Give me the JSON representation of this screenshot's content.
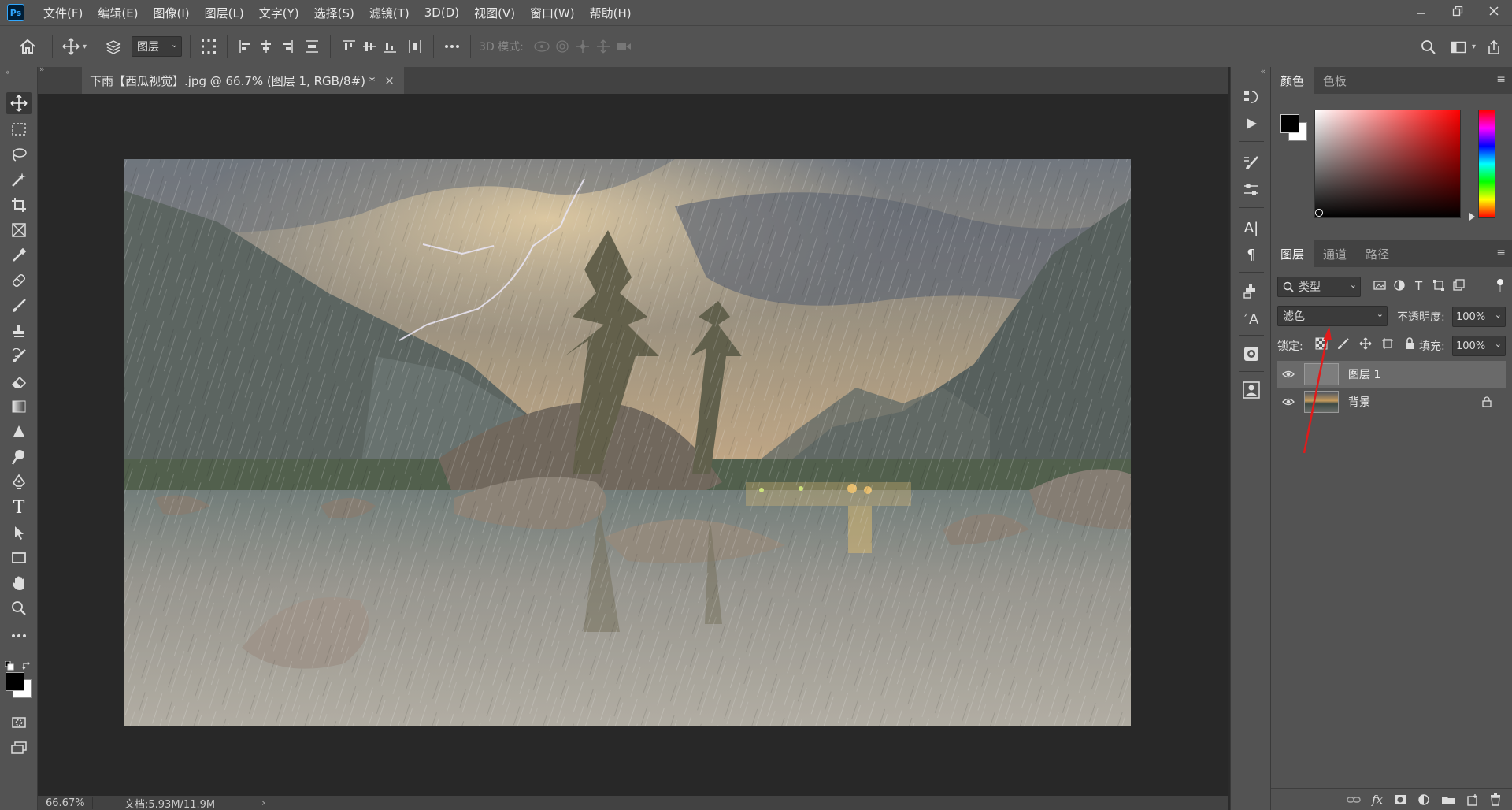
{
  "app": {
    "logo": "Ps"
  },
  "menu": [
    "文件(F)",
    "编辑(E)",
    "图像(I)",
    "图层(L)",
    "文字(Y)",
    "选择(S)",
    "滤镜(T)",
    "3D(D)",
    "视图(V)",
    "窗口(W)",
    "帮助(H)"
  ],
  "options": {
    "layer_select": "图层",
    "mode3d_label": "3D 模式:"
  },
  "document": {
    "tab_title": "下雨【西瓜视觉】.jpg @ 66.7% (图层 1, RGB/8#) *"
  },
  "status": {
    "zoom": "66.67%",
    "doc_size": "文档:5.93M/11.9M",
    "arrow": "›"
  },
  "color_panel": {
    "tabs": [
      "颜色",
      "色板"
    ],
    "hue_gradient": [
      "#ff0000",
      "#ff00ff",
      "#0000ff",
      "#00ffff",
      "#00ff00",
      "#ffff00",
      "#ff0000"
    ],
    "foreground": "#000000",
    "background": "#ffffff",
    "base_hue": "#ff0000"
  },
  "layers_panel": {
    "tabs": [
      "图层",
      "通道",
      "路径"
    ],
    "filter_label": "类型",
    "blend_mode": "滤色",
    "opacity_label": "不透明度:",
    "opacity_value": "100%",
    "lock_label": "锁定:",
    "fill_label": "填充:",
    "fill_value": "100%",
    "layers": [
      {
        "name": "图层 1",
        "selected": true
      },
      {
        "name": "背景",
        "locked": true
      }
    ]
  }
}
